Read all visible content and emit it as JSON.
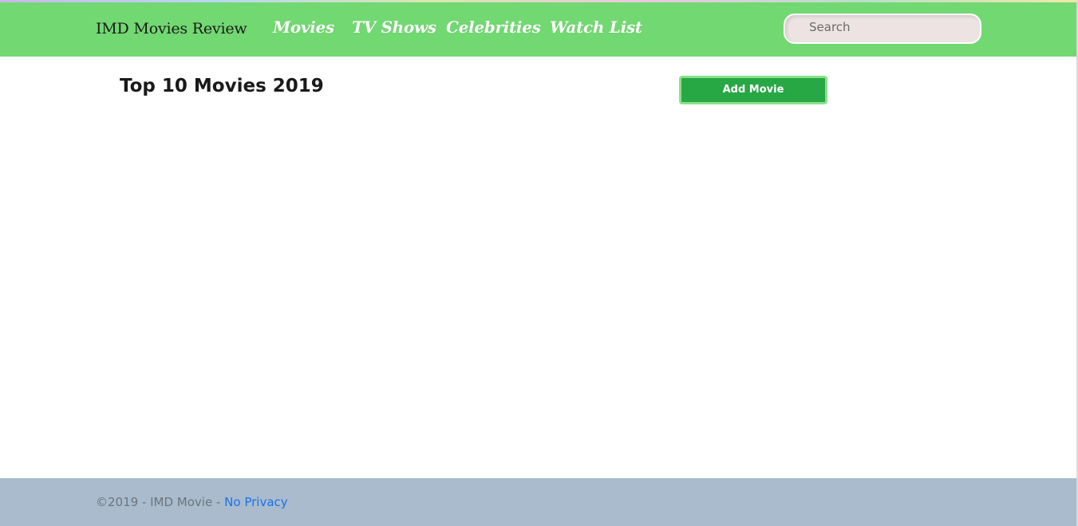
{
  "navbar": {
    "brand": "IMD Movies Review",
    "links": [
      {
        "label": "Movies"
      },
      {
        "label": "TV Shows"
      },
      {
        "label": "Celebrities"
      },
      {
        "label": "Watch List"
      }
    ],
    "search": {
      "placeholder": "Search",
      "value": ""
    },
    "background_color": "#72d872"
  },
  "main": {
    "title": "Top 10 Movies 2019",
    "add_button_label": "Add Movie",
    "accent_color": "#28a745"
  },
  "footer": {
    "copyright": "©2019 - IMD Movie - ",
    "privacy_link": "No Privacy",
    "background_color": "#a9bbcd"
  }
}
